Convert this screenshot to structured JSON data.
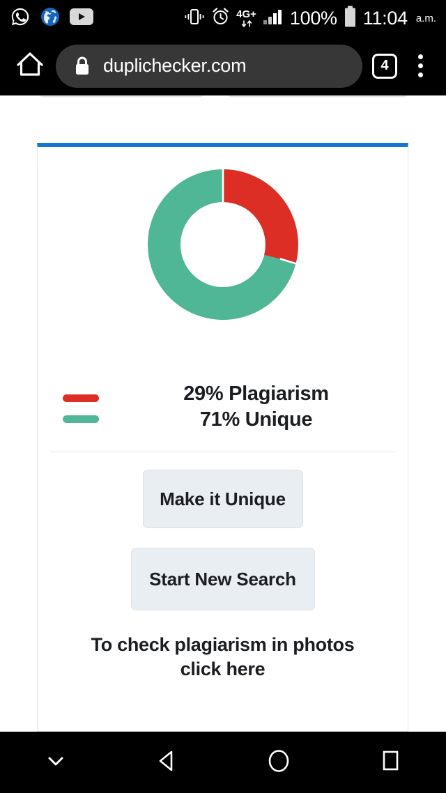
{
  "status_bar": {
    "notification_icons": [
      {
        "name": "whatsapp-icon",
        "label": "WhatsApp"
      },
      {
        "name": "globe-icon",
        "label": "Browser"
      },
      {
        "name": "youtube-icon",
        "label": "YouTube"
      }
    ],
    "system_icons": [
      {
        "name": "vibrate-icon",
        "label": "Vibrate"
      },
      {
        "name": "alarm-icon",
        "label": "Alarm"
      },
      {
        "name": "network-type-icon",
        "label": "4G+"
      },
      {
        "name": "signal-icon",
        "label": "Signal"
      }
    ],
    "network_type": "4G+",
    "battery_percent": "100%",
    "time": "11:04",
    "am_pm": "a.m."
  },
  "browser": {
    "home_label": "Home",
    "lock_label": "Secure",
    "url": "duplichecker.com",
    "tab_count": "4",
    "menu_label": "More options"
  },
  "card": {
    "accent_color": "#1477d1"
  },
  "chart_data": {
    "type": "pie",
    "title": "",
    "variant": "donut",
    "categories": [
      "Plagiarism",
      "Unique"
    ],
    "values": [
      29,
      71
    ],
    "value_unit": "%",
    "colors": [
      "#dd2e26",
      "#4fb795"
    ],
    "start_angle_deg": 0,
    "direction": "clockwise",
    "inner_radius_ratio": 0.57,
    "legend_position": "bottom",
    "legend": [
      {
        "label": "29% Plagiarism",
        "color": "#dd2e26"
      },
      {
        "label": "71% Unique",
        "color": "#4fb795"
      }
    ]
  },
  "legend": {
    "line1": "29% Plagiarism",
    "line2": "71% Unique",
    "color1": "#dd2e26",
    "color2": "#4fb795"
  },
  "actions": {
    "make_unique": "Make it Unique",
    "start_new_search": "Start New Search"
  },
  "footer": {
    "photo_note_line1": "To check plagiarism in photos",
    "photo_note_line2": "click here"
  },
  "nav_bar": {
    "buttons": [
      {
        "name": "hide-keyboard-icon",
        "label": "Hide"
      },
      {
        "name": "back-icon",
        "label": "Back"
      },
      {
        "name": "home-icon",
        "label": "Home"
      },
      {
        "name": "recents-icon",
        "label": "Recents"
      }
    ]
  }
}
